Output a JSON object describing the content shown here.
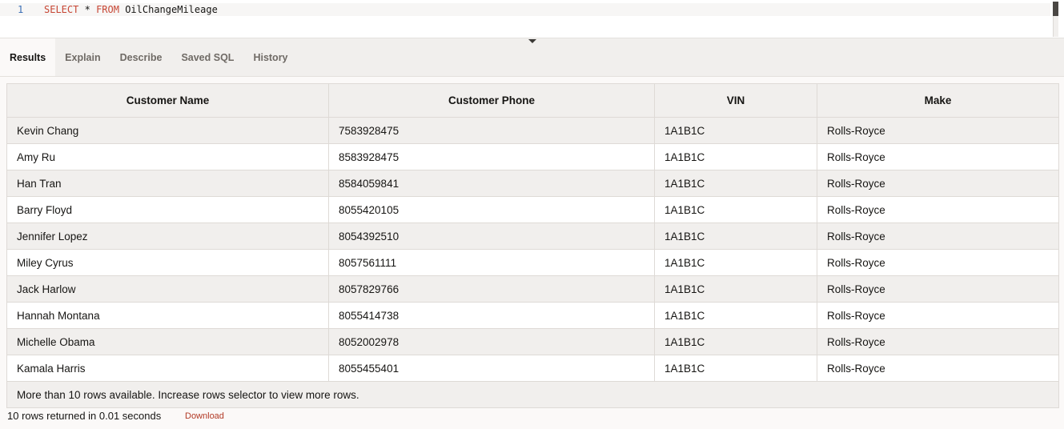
{
  "editor": {
    "line_number": "1",
    "sql": {
      "kw1": "SELECT",
      "op": "*",
      "kw2": "FROM",
      "table": "OilChangeMileage"
    }
  },
  "tabs": [
    {
      "label": "Results",
      "active": true
    },
    {
      "label": "Explain",
      "active": false
    },
    {
      "label": "Describe",
      "active": false
    },
    {
      "label": "Saved SQL",
      "active": false
    },
    {
      "label": "History",
      "active": false
    }
  ],
  "results": {
    "columns": [
      "Customer Name",
      "Customer Phone",
      "VIN",
      "Make"
    ],
    "rows": [
      [
        "Kevin Chang",
        "7583928475",
        "1A1B1C",
        "Rolls-Royce"
      ],
      [
        "Amy Ru",
        "8583928475",
        "1A1B1C",
        "Rolls-Royce"
      ],
      [
        "Han Tran",
        "8584059841",
        "1A1B1C",
        "Rolls-Royce"
      ],
      [
        "Barry Floyd",
        "8055420105",
        "1A1B1C",
        "Rolls-Royce"
      ],
      [
        "Jennifer Lopez",
        "8054392510",
        "1A1B1C",
        "Rolls-Royce"
      ],
      [
        "Miley Cyrus",
        "8057561111",
        "1A1B1C",
        "Rolls-Royce"
      ],
      [
        "Jack Harlow",
        "8057829766",
        "1A1B1C",
        "Rolls-Royce"
      ],
      [
        "Hannah Montana",
        "8055414738",
        "1A1B1C",
        "Rolls-Royce"
      ],
      [
        "Michelle Obama",
        "8052002978",
        "1A1B1C",
        "Rolls-Royce"
      ],
      [
        "Kamala Harris",
        "8055455401",
        "1A1B1C",
        "Rolls-Royce"
      ]
    ],
    "more_rows_note": "More than 10 rows available. Increase rows selector to view more rows."
  },
  "status": {
    "summary": "10 rows returned in 0.01 seconds",
    "download_label": "Download"
  },
  "colors": {
    "keyword": "#c74634",
    "link": "#b23a26",
    "stripe": "#f1efed"
  }
}
